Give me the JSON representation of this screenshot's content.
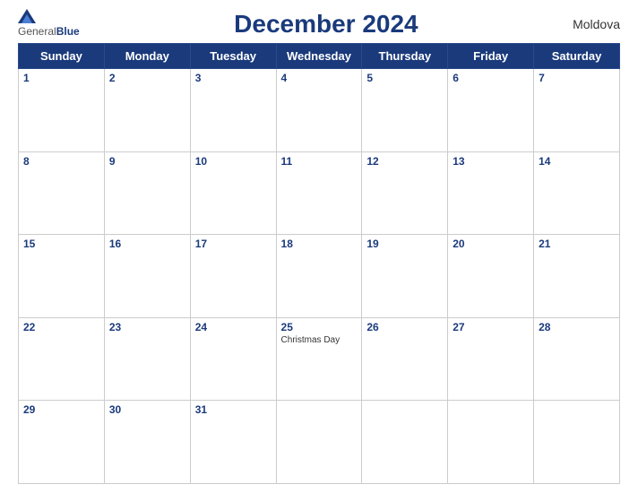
{
  "header": {
    "logo_general": "General",
    "logo_blue": "Blue",
    "title": "December 2024",
    "country": "Moldova"
  },
  "weekdays": [
    "Sunday",
    "Monday",
    "Tuesday",
    "Wednesday",
    "Thursday",
    "Friday",
    "Saturday"
  ],
  "weeks": [
    [
      {
        "day": "1",
        "holiday": ""
      },
      {
        "day": "2",
        "holiday": ""
      },
      {
        "day": "3",
        "holiday": ""
      },
      {
        "day": "4",
        "holiday": ""
      },
      {
        "day": "5",
        "holiday": ""
      },
      {
        "day": "6",
        "holiday": ""
      },
      {
        "day": "7",
        "holiday": ""
      }
    ],
    [
      {
        "day": "8",
        "holiday": ""
      },
      {
        "day": "9",
        "holiday": ""
      },
      {
        "day": "10",
        "holiday": ""
      },
      {
        "day": "11",
        "holiday": ""
      },
      {
        "day": "12",
        "holiday": ""
      },
      {
        "day": "13",
        "holiday": ""
      },
      {
        "day": "14",
        "holiday": ""
      }
    ],
    [
      {
        "day": "15",
        "holiday": ""
      },
      {
        "day": "16",
        "holiday": ""
      },
      {
        "day": "17",
        "holiday": ""
      },
      {
        "day": "18",
        "holiday": ""
      },
      {
        "day": "19",
        "holiday": ""
      },
      {
        "day": "20",
        "holiday": ""
      },
      {
        "day": "21",
        "holiday": ""
      }
    ],
    [
      {
        "day": "22",
        "holiday": ""
      },
      {
        "day": "23",
        "holiday": ""
      },
      {
        "day": "24",
        "holiday": ""
      },
      {
        "day": "25",
        "holiday": "Christmas Day"
      },
      {
        "day": "26",
        "holiday": ""
      },
      {
        "day": "27",
        "holiday": ""
      },
      {
        "day": "28",
        "holiday": ""
      }
    ],
    [
      {
        "day": "29",
        "holiday": ""
      },
      {
        "day": "30",
        "holiday": ""
      },
      {
        "day": "31",
        "holiday": ""
      },
      {
        "day": "",
        "holiday": ""
      },
      {
        "day": "",
        "holiday": ""
      },
      {
        "day": "",
        "holiday": ""
      },
      {
        "day": "",
        "holiday": ""
      }
    ]
  ]
}
